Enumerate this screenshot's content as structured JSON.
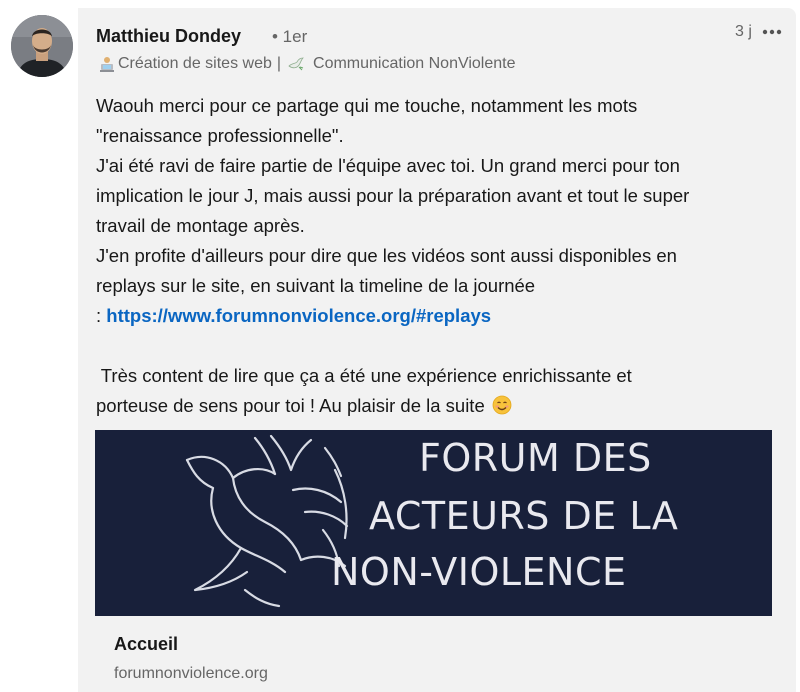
{
  "comment": {
    "author_name": "Matthieu Dondey",
    "degree": "• 1er",
    "headline_part1": "Création de sites web",
    "headline_separator": "|",
    "headline_part2": "Communication NonViolente",
    "time_ago": "3 j",
    "more_icon": "ellipsis-icon",
    "text_lines": [
      "Waouh merci pour ce partage qui me touche, notamment les mots",
      "\"renaissance professionnelle\".",
      "J'ai été ravi de faire partie de l'équipe avec toi. Un grand merci pour ton",
      "implication le jour J, mais aussi pour la préparation avant et tout le super",
      "travail de montage après.",
      "J'en profite d'ailleurs pour dire que les vidéos sont aussi disponibles en",
      "replays sur le site, en suivant la timeline de la journée"
    ],
    "link_prefix": ": ",
    "link_url": "https://www.forumnonviolence.org/#replays",
    "closing_line1": " Très content de lire que ça a été une expérience enrichissante et",
    "closing_line2": "porteuse de sens pour toi ! Au plaisir de la suite",
    "closing_emoji": "smiling-face-emoji"
  },
  "link_preview": {
    "image_text_line1": "FORUM DES",
    "image_text_line2": "ACTEURS DE LA",
    "image_text_line3": "NON-VIOLENCE",
    "image_background": "#18203a",
    "title": "Accueil",
    "domain": "forumnonviolence.org"
  },
  "colors": {
    "link": "#0a66c2",
    "bubble_background": "#f2f2f2",
    "secondary_text": "#666666"
  }
}
